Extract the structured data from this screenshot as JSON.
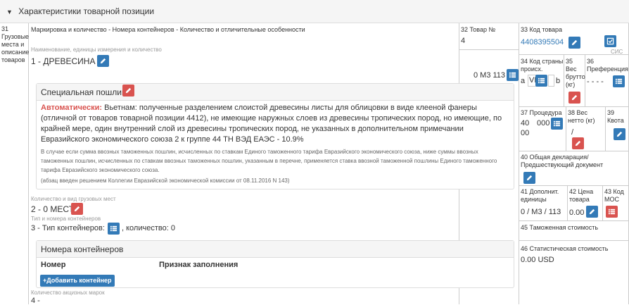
{
  "section": {
    "title": "Характеристики товарной позиции"
  },
  "col31": {
    "label": "31 Грузовые места и описание товаров",
    "title": "Маркировка и количество - Номера контейнеров - Количество и отличительные особенности"
  },
  "goods": {
    "name_label": "Наименование, единицы измерения и количество",
    "name_value": "1 - ДРЕВЕСИНА",
    "qty_text": "0 М3 113"
  },
  "duty": {
    "title": "Специальная пошлина",
    "auto_label": "Автоматически:",
    "text": "Вьетнам: полученные разделением слоистой древесины листы для облицовки в виде клееной фанеры (отличной от товаров товарной позиции 4412), не имеющие наружных слоев из древесины тропических пород, но имеющие, по крайней мере, один внутренний слой из древесины тропических пород, не указанных в дополнительном примечании Евразийского экономического союза 2 к группе 44 ТН ВЭД ЕАЭС - 10.9%",
    "note": "В случае если сумма ввозных таможенных пошлин, исчисленных по ставкам Единого таможенного тарифа Евразийского экономического союза, ниже суммы ввозных таможенных пошлин, исчисленных по ставкам ввозных таможенных пошлин, указанным в перечне, применяется ставка ввозной таможенной пошлины Единого таможенного тарифа Евразийского экономического союза.",
    "source": "(абзац введен решением Коллегии Евразийской экономической комиссии от 08.11.2016 N 143)"
  },
  "packages": {
    "label": "Количество и вид грузовых мест",
    "value": "2 - 0 МЕСТ"
  },
  "containers": {
    "label": "Тип и номера контейнеров",
    "type_text": "3 - Тип контейнеров:",
    "count_text": ", количество: 0",
    "panel_title": "Номера контейнеров",
    "col_number": "Номер",
    "col_fill": "Признак заполнения",
    "add_label": "Добавить контейнер"
  },
  "excise": {
    "label": "Количество акцизных марок",
    "value": "4 -"
  },
  "box32": {
    "label": "32 Товар №",
    "value": "4"
  },
  "box33": {
    "label": "33 Код товара",
    "value": "4408395504",
    "cis": "СИС"
  },
  "box34": {
    "label": "34 Код страны происх.",
    "a": "a",
    "country": "VN",
    "b": "b"
  },
  "box35": {
    "label": "35 Вес брутто (кг)"
  },
  "box36": {
    "label": "36 Преференция",
    "value": "- - - -"
  },
  "box37": {
    "label": "37 Процедура",
    "v1": "40",
    "v2": "00",
    "v3": "000"
  },
  "box38": {
    "label": "38 Вес нетто (кг)",
    "value": "/"
  },
  "box39": {
    "label": "39 Квота"
  },
  "box40": {
    "label": "40 Общая декларация/ Предшествующий документ"
  },
  "box41": {
    "label": "41 Дополнит. единицы",
    "value": "0 / М3 / 113"
  },
  "box42": {
    "label": "42 Цена товара",
    "value": "0.00"
  },
  "box43": {
    "label": "43 Код МОС"
  },
  "box45": {
    "label": "45 Таможенная стоимость"
  },
  "box46": {
    "label": "46 Статистическая стоимость",
    "value": "0.00 USD"
  },
  "colors": {
    "accent": "#337ab7",
    "danger": "#d9534f"
  }
}
